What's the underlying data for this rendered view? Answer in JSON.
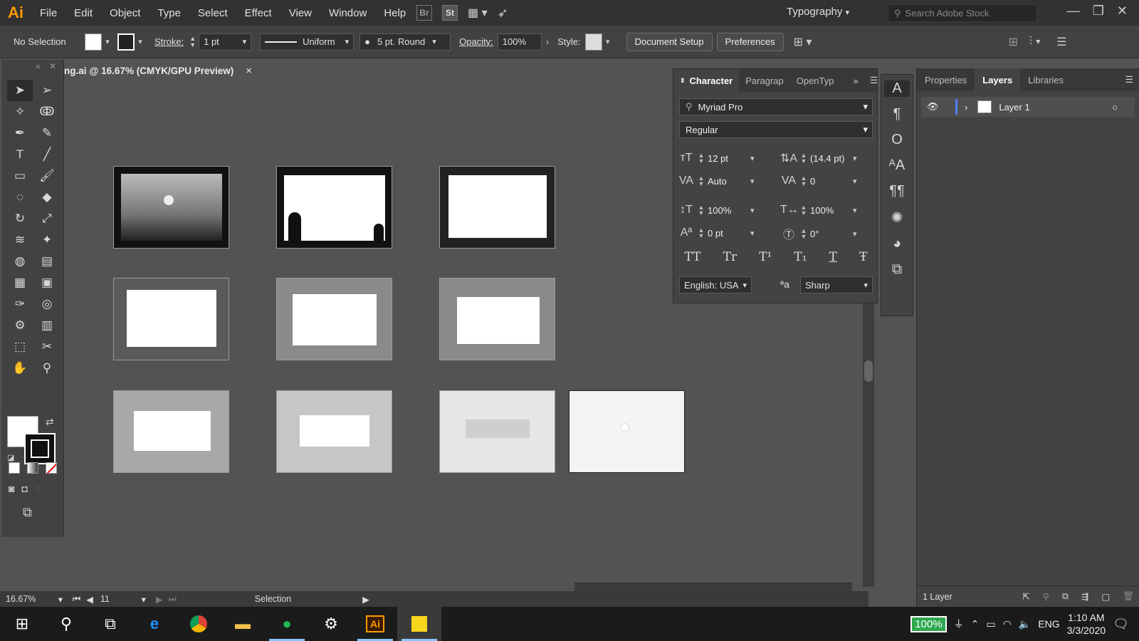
{
  "app": {
    "logo": "Ai"
  },
  "menu": [
    "File",
    "Edit",
    "Object",
    "Type",
    "Select",
    "Effect",
    "View",
    "Window",
    "Help"
  ],
  "app_icons": {
    "bridge": "Br",
    "stock": "St"
  },
  "workspace": {
    "label": "Typography"
  },
  "stock_search": {
    "placeholder": "Search Adobe Stock"
  },
  "control_bar": {
    "selection": "No Selection",
    "stroke_label": "Stroke:",
    "stroke_weight": "1 pt",
    "profile": "Uniform",
    "brush": "5 pt. Round",
    "opacity_label": "Opacity:",
    "opacity": "100%",
    "style_label": "Style:",
    "document_setup": "Document Setup",
    "preferences": "Preferences"
  },
  "document_tab": {
    "title": "ng.ai @ 16.67% (CMYK/GPU Preview)",
    "close": "×"
  },
  "status_bar": {
    "zoom": "16.67%",
    "artboard": "11",
    "tool": "Selection"
  },
  "character_panel": {
    "tabs": [
      "Character",
      "Paragrap",
      "OpenTyp"
    ],
    "font_family": "Myriad Pro",
    "font_style": "Regular",
    "font_size": "12 pt",
    "leading": "(14.4 pt)",
    "kerning": "Auto",
    "tracking": "0",
    "vertical_scale": "100%",
    "horizontal_scale": "100%",
    "baseline_shift": "0 pt",
    "rotation": "0°",
    "glyph_buttons": [
      "TT",
      "Tr",
      "T¹",
      "T₁",
      "T",
      "Ŧ"
    ],
    "language": "English: USA",
    "aa_label": "ªa",
    "antialias": "Sharp"
  },
  "right_panel": {
    "tabs": [
      "Properties",
      "Layers",
      "Libraries"
    ],
    "active_tab": "Layers",
    "layers": [
      {
        "name": "Layer 1"
      }
    ],
    "footer": "1 Layer"
  },
  "taskbar": {
    "battery": "100%",
    "language": "ENG",
    "time": "1:10 AM",
    "date": "3/3/2020",
    "ai_label": "Ai"
  },
  "colors": {
    "accent": "#ff9a00",
    "layer_color": "#4f7fff",
    "battery": "#2fa84f"
  }
}
